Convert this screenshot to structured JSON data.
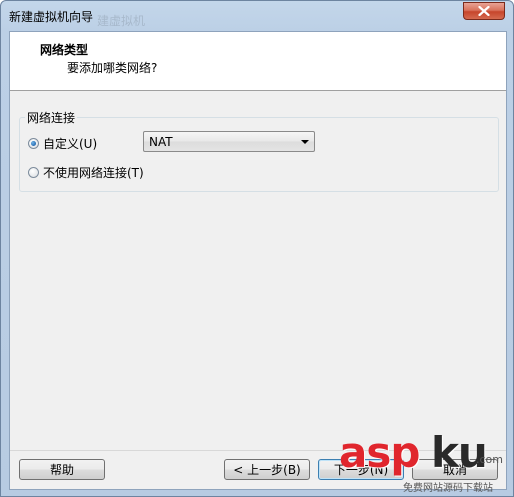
{
  "window": {
    "title": "新建虚拟机向导",
    "title_ghost": "建虚拟机"
  },
  "header": {
    "title": "网络类型",
    "subtitle": "要添加哪类网络?"
  },
  "network_group": {
    "label": "网络连接",
    "options": [
      {
        "label": "自定义(U)",
        "checked": true
      },
      {
        "label": "不使用网络连接(T)",
        "checked": false
      }
    ],
    "select_value": "NAT"
  },
  "footer": {
    "help_label": "帮助",
    "back_label": "< 上一步(B)",
    "next_label": "下一步(N)",
    "cancel_label": "取消"
  },
  "watermark": {
    "part1": "asp",
    "part2": "ku",
    "suffix": ".com",
    "subtitle": "免费网站源码下载站"
  }
}
